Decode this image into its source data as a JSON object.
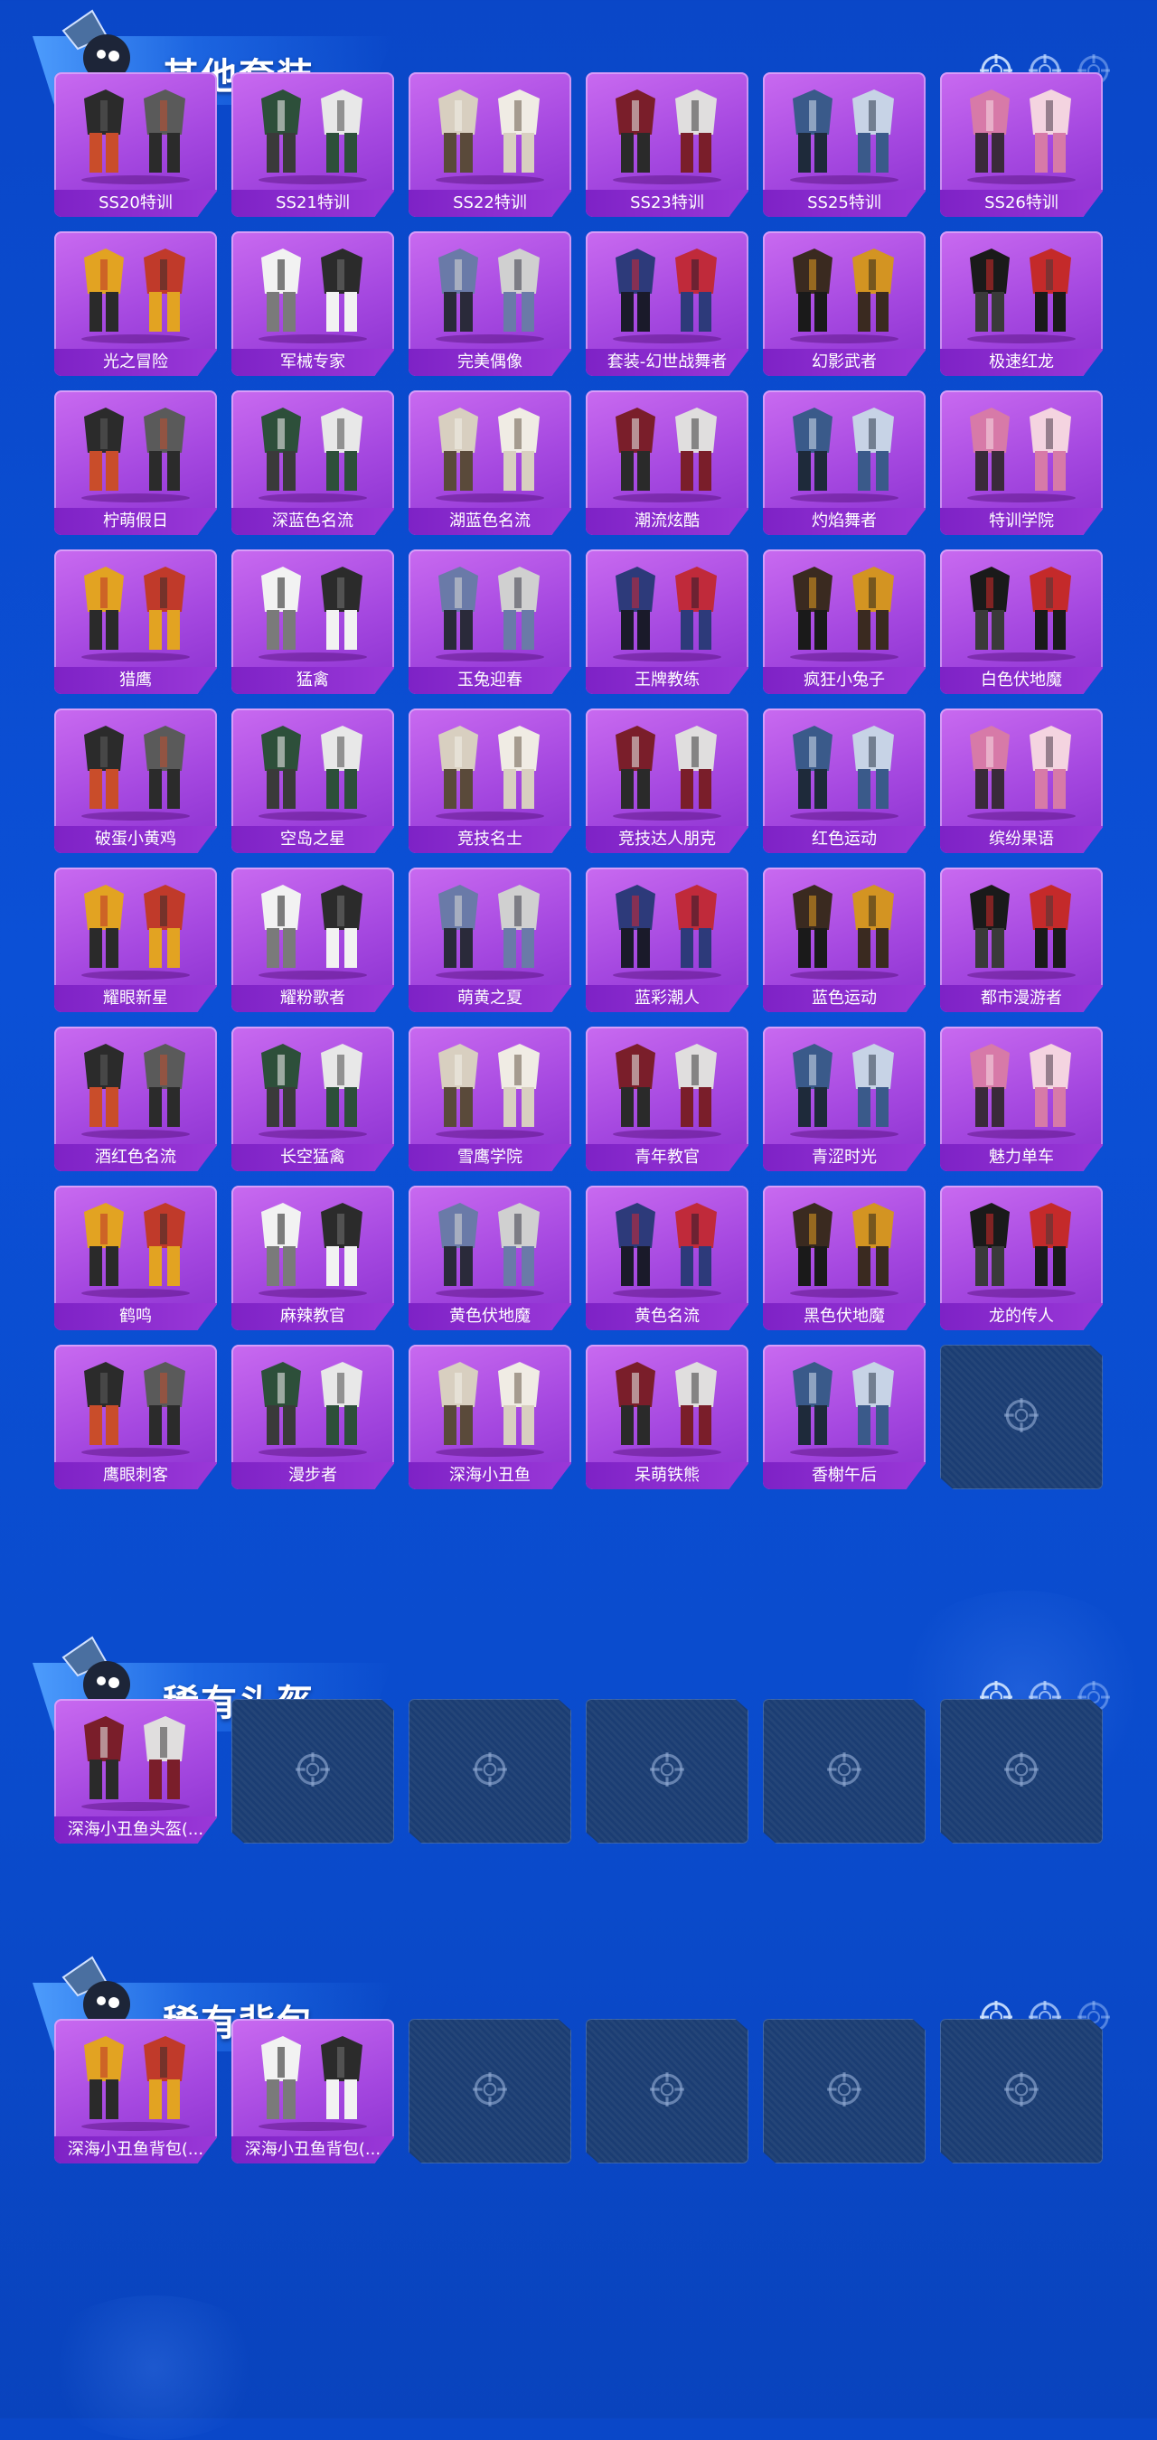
{
  "colors": {
    "accent": "#4fa3ff",
    "card": "#a548e0",
    "label_bar": "#8a2fd0",
    "empty_slot": "#1b3d73"
  },
  "sections": [
    {
      "title": "其他套装",
      "items": [
        "SS20特训",
        "SS21特训",
        "SS22特训",
        "SS23特训",
        "SS25特训",
        "SS26特训",
        "光之冒险",
        "军械专家",
        "完美偶像",
        "套装-幻世战舞者",
        "幻影武者",
        "极速红龙",
        "柠萌假日",
        "深蓝色名流",
        "湖蓝色名流",
        "潮流炫酷",
        "灼焰舞者",
        "特训学院",
        "猎鹰",
        "猛禽",
        "玉兔迎春",
        "王牌教练",
        "疯狂小兔子",
        "白色伏地魔",
        "破蛋小黄鸡",
        "空岛之星",
        "竞技名士",
        "竞技达人朋克",
        "红色运动",
        "缤纷果语",
        "耀眼新星",
        "耀粉歌者",
        "萌黄之夏",
        "蓝彩潮人",
        "蓝色运动",
        "都市漫游者",
        "酒红色名流",
        "长空猛禽",
        "雪鹰学院",
        "青年教官",
        "青涩时光",
        "魅力单车",
        "鹤鸣",
        "麻辣教官",
        "黄色伏地魔",
        "黄色名流",
        "黑色伏地魔",
        "龙的传人",
        "鹰眼刺客",
        "漫步者",
        "深海小丑鱼",
        "呆萌铁熊",
        "香榭午后"
      ],
      "empty_slots": 1
    },
    {
      "title": "稀有头盔",
      "items": [
        "深海小丑鱼头盔(..."
      ],
      "empty_slots": 5
    },
    {
      "title": "稀有背包",
      "items": [
        "深海小丑鱼背包(...",
        "深海小丑鱼背包(..."
      ],
      "empty_slots": 4
    }
  ]
}
